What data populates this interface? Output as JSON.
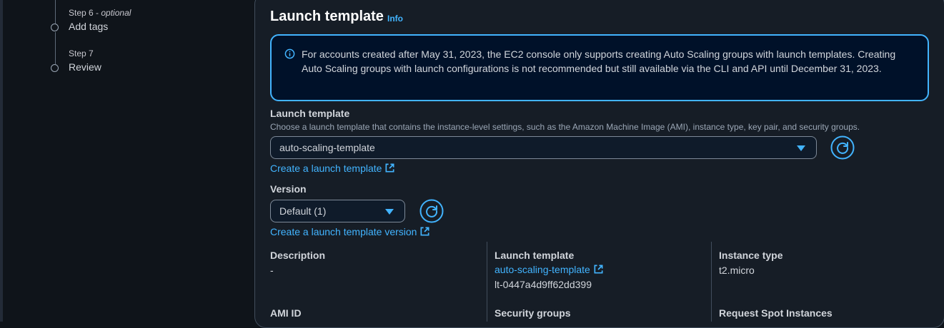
{
  "steps": [
    {
      "meta": "Step 6",
      "meta_suffix": "optional",
      "title": "Add tags"
    },
    {
      "meta": "Step 7",
      "meta_suffix": "",
      "title": "Review"
    }
  ],
  "header": {
    "title": "Launch template",
    "info": "Info"
  },
  "alert": {
    "icon": "info-icon",
    "text": "For accounts created after May 31, 2023, the EC2 console only supports creating Auto Scaling groups with launch templates. Creating Auto Scaling groups with launch configurations is not recommended but still available via the CLI and API until December 31, 2023."
  },
  "launch_template_field": {
    "label": "Launch template",
    "description": "Choose a launch template that contains the instance-level settings, such as the Amazon Machine Image (AMI), instance type, key pair, and security groups.",
    "value": "auto-scaling-template",
    "create_link": "Create a launch template"
  },
  "version_field": {
    "label": "Version",
    "value": "Default (1)",
    "create_link": "Create a launch template version"
  },
  "details": {
    "description_label": "Description",
    "description_value": "-",
    "launch_template_label": "Launch template",
    "launch_template_link": "auto-scaling-template",
    "launch_template_id": "lt-0447a4d9ff62dd399",
    "instance_type_label": "Instance type",
    "instance_type_value": "t2.micro",
    "ami_id_label": "AMI ID",
    "security_groups_label": "Security groups",
    "spot_label": "Request Spot Instances"
  },
  "colors": {
    "accent": "#42b4ff",
    "background": "#0f141a",
    "panel": "#161d26"
  }
}
